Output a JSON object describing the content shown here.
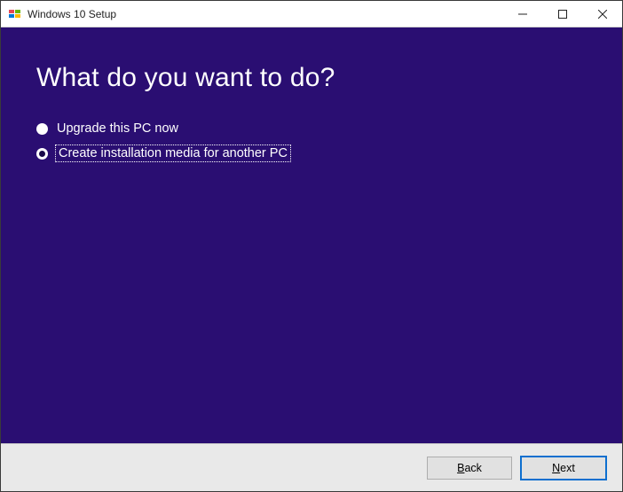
{
  "titlebar": {
    "title": "Windows 10 Setup"
  },
  "content": {
    "heading": "What do you want to do?",
    "options": [
      {
        "label": "Upgrade this PC now",
        "selected": false,
        "focused": false
      },
      {
        "label": "Create installation media for another PC",
        "selected": true,
        "focused": true
      }
    ]
  },
  "footer": {
    "back_prefix": "B",
    "back_rest": "ack",
    "next_prefix": "N",
    "next_rest": "ext"
  }
}
